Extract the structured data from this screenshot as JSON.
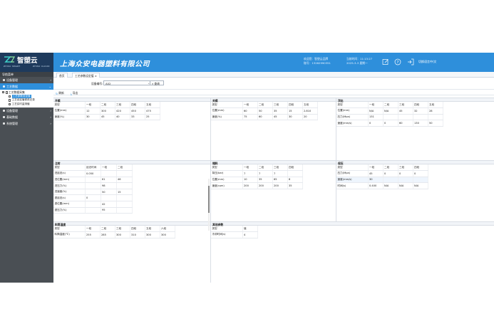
{
  "header": {
    "logo_text": "智塑云",
    "logo_sub_left": "ZHISU SMART",
    "logo_sub_right": "ZHISU CLOUD",
    "company": "上海众安电器塑料有限公司",
    "welcome_label": "欢迎您：智塑云品牌",
    "account_label": "账号：13262990351",
    "date_label": "当前时间：11:13:27",
    "date_value": "2025-3-3 星期一",
    "lang_label": "切换语言中/文"
  },
  "sidebar": {
    "title": "导航菜单",
    "items": [
      {
        "label": "设备管理"
      },
      {
        "label": "工艺数据"
      },
      {
        "label": "设备管理"
      },
      {
        "label": "基础数据"
      },
      {
        "label": "系统管理"
      }
    ],
    "tree": {
      "root": "工艺数据采集",
      "leaves": [
        "工艺参数设定值",
        "工艺设定值修改记录",
        "工艺实时监测值"
      ]
    }
  },
  "tabs": [
    {
      "label": "首页"
    },
    {
      "label": "工艺参数设定值 ×"
    }
  ],
  "filter": {
    "device_label": "设备编号:",
    "device_value": "A02",
    "search_label": "查询"
  },
  "toolbar": {
    "refresh_label": "刷新",
    "export_label": "导出"
  },
  "panels": {
    "open_mold": {
      "title": "开模",
      "rows": [
        [
          "类型",
          "一段",
          "二段",
          "三段",
          "四段",
          "五段"
        ],
        [
          "位置(mm)",
          "12",
          "300",
          "420",
          "450",
          "475"
        ],
        [
          "速度(%)",
          "30",
          "45",
          "40",
          "33",
          "25"
        ]
      ]
    },
    "close_mold": {
      "title": "关模",
      "rows": [
        [
          "类型",
          "一段",
          "二段",
          "三段",
          "四段",
          "五段"
        ],
        [
          "位置(mm)",
          "60",
          "50",
          "35",
          "15",
          "2.810"
        ],
        [
          "速度(%)",
          "75",
          "60",
          "45",
          "30",
          "20"
        ]
      ]
    },
    "eject": {
      "title": "顶出",
      "rows": [
        [
          "类型",
          "一段",
          "二段",
          "三段",
          "四段",
          "五段"
        ],
        [
          "位置(mm)",
          "N/A",
          "N/A",
          "45",
          "32",
          "28"
        ],
        [
          "压力(Mpa)",
          "131",
          "",
          "",
          "",
          ""
        ],
        [
          "速度(mm/s)",
          "0",
          "0",
          "60",
          "130",
          "50"
        ]
      ]
    },
    "injection": {
      "title": "注射",
      "rows": [
        [
          "类型",
          "延迟时间",
          "一段",
          "二段"
        ],
        [
          "进延迟(s)",
          "0.050",
          "",
          ""
        ],
        [
          "进位置(mm)",
          "",
          "61",
          "46"
        ],
        [
          "进压力(%)",
          "",
          "98",
          ""
        ],
        [
          "进速度(%)",
          "",
          "50",
          "15"
        ],
        [
          "退延迟(s)",
          "0",
          "",
          ""
        ],
        [
          "退位置(mm)",
          "",
          "42",
          ""
        ],
        [
          "退压力(%)",
          "",
          "95",
          ""
        ]
      ]
    },
    "storage": {
      "title": "储料",
      "rows": [
        [
          "类型",
          "一段",
          "二段",
          "三段",
          "四段"
        ],
        [
          "背压(bar)",
          "7",
          "7",
          "7",
          ""
        ],
        [
          "位置(mm)",
          "10",
          "35",
          "65",
          "8"
        ],
        [
          "速度(rpm)",
          "200",
          "200",
          "200",
          "35"
        ]
      ]
    },
    "hold": {
      "title": "保压",
      "rows": [
        [
          "类型",
          "一段",
          "二段",
          "三段",
          "四段"
        ],
        [
          "压力(Mpa)",
          "45",
          "0",
          "0",
          "0"
        ],
        [
          "速度(mm/s)",
          "30",
          "",
          "",
          ""
        ],
        [
          "时间(s)",
          "0.400",
          "N/A",
          "N/A",
          "N/A"
        ]
      ]
    },
    "barrel_temp": {
      "title": "料筒温度",
      "rows": [
        [
          "类型",
          "一段",
          "二段",
          "三段",
          "四段",
          "五段",
          "六段"
        ],
        [
          "料筒温度(℃)",
          "255",
          "285",
          "300",
          "310",
          "300",
          "300"
        ]
      ]
    },
    "other": {
      "title": "其他参数",
      "rows": [
        [
          "类型",
          "值"
        ],
        [
          "冷却时间(s)",
          "4"
        ]
      ]
    }
  },
  "colors": {
    "topbar": "#2e8fdb",
    "sidebar": "#4a4f54",
    "active": "#2e8fdb"
  }
}
